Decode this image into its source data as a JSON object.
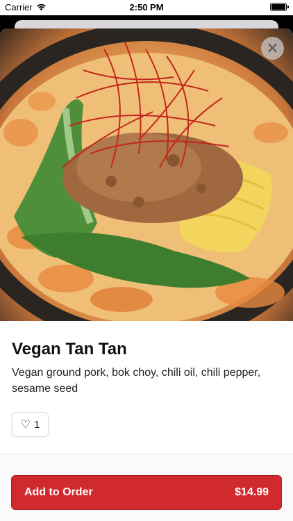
{
  "status_bar": {
    "carrier": "Carrier",
    "time": "2:50 PM"
  },
  "item": {
    "image_alt": "Vegan Tan Tan ramen bowl",
    "title": "Vegan Tan Tan",
    "description": "Vegan ground pork, bok choy, chili oil, chili pepper, sesame seed",
    "likes": "1"
  },
  "actions": {
    "add_to_order_label": "Add to Order",
    "price": "$14.99"
  },
  "colors": {
    "accent": "#d12a2e",
    "background": "#ffffff"
  },
  "icons": {
    "close": "close-icon",
    "like": "heart-icon",
    "wifi": "wifi-icon",
    "battery": "battery-icon"
  }
}
